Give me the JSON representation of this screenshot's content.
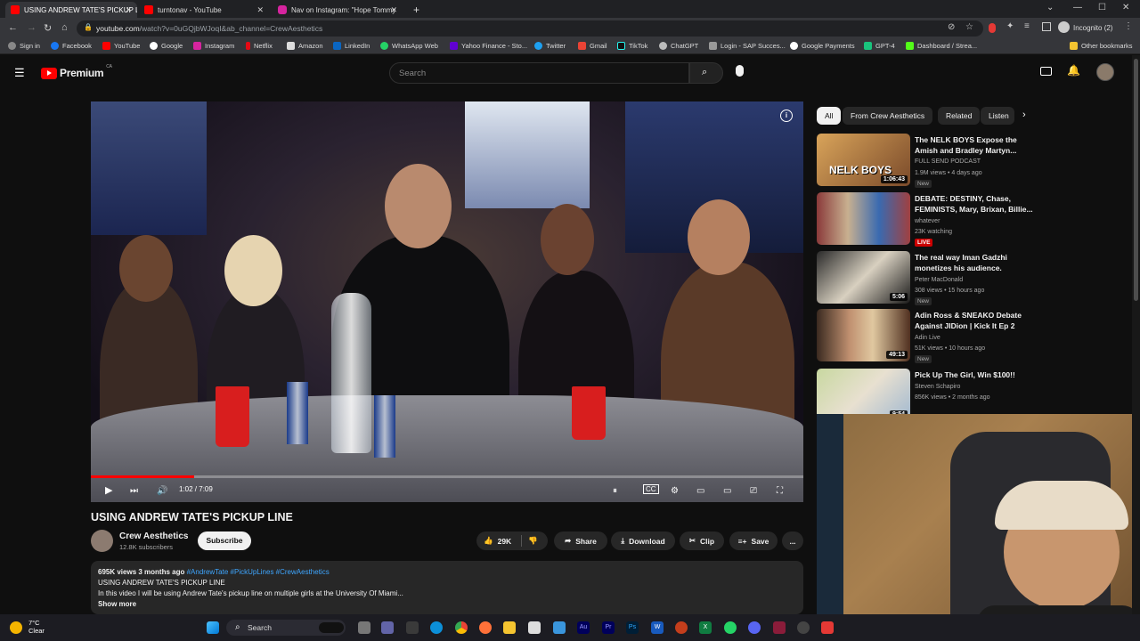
{
  "browser": {
    "tabs": [
      {
        "title": "USING ANDREW TATE'S PICKUP L",
        "favicon_color": "#ff0000"
      },
      {
        "title": "turntonav - YouTube",
        "favicon_color": "#ff0000"
      },
      {
        "title": "Nav on Instagram: \"Hope Tommy",
        "favicon_color": "#d6249f"
      }
    ],
    "new_tab": "+",
    "url_domain": "youtube.com",
    "url_path": "/watch?v=0uGQjbWJoqI&ab_channel=CrewAesthetics",
    "profile": "Incognito (2)",
    "bookmarks": [
      "Sign in",
      "Facebook",
      "YouTube",
      "Google",
      "Instagram",
      "Netflix",
      "Amazon",
      "LinkedIn",
      "WhatsApp Web",
      "Yahoo Finance - Sto...",
      "Twitter",
      "Gmail",
      "TikTok",
      "ChatGPT",
      "Login - SAP Succes...",
      "Google Payments",
      "GPT-4",
      "Dashboard / Strea..."
    ],
    "other_bookmarks": "Other bookmarks"
  },
  "youtube": {
    "logo_text": "Premium",
    "region": "CA",
    "search_placeholder": "Search",
    "video": {
      "time": "1:02 / 7:09",
      "progress": 0.145,
      "title": "USING ANDREW TATE'S PICKUP LINE",
      "channel": "Crew Aesthetics",
      "subscribers": "12.8K subscribers",
      "subscribe_label": "Subscribe",
      "likes": "29K",
      "share": "Share",
      "download": "Download",
      "clip": "Clip",
      "save": "Save",
      "more": "..."
    },
    "description": {
      "stats": "695K views  3 months ago",
      "hashtags": "#AndrewTate #PickUpLines #CrewAesthetics",
      "line1": "USING ANDREW TATE'S PICKUP LINE",
      "line2": "In this video I will be using Andrew Tate's pickup line on multiple girls at the University Of Miami...",
      "show_more": "Show more"
    },
    "chips": [
      "All",
      "From Crew Aesthetics",
      "Related",
      "Listen"
    ],
    "recommendations": [
      {
        "title": "The NELK BOYS Expose the Amish and Bradley Martyn...",
        "channel": "FULL SEND PODCAST",
        "meta": "1.9M views • 4 days ago",
        "badge": "New",
        "duration": "1:06:43",
        "thumb_text": "NELK BOYS"
      },
      {
        "title": "DEBATE: DESTINY, Chase, FEMINISTS, Mary, Brixan, Billie...",
        "channel": "whatever",
        "meta": "23K watching",
        "badge": "LIVE",
        "duration": "",
        "thumb_text": ""
      },
      {
        "title": "The real way Iman Gadzhi monetizes his audience.",
        "channel": "Peter MacDonald",
        "meta": "308 views • 15 hours ago",
        "badge": "New",
        "duration": "5:06",
        "thumb_text": ""
      },
      {
        "title": "Adin Ross & SNEAKO Debate Against JIDion | Kick It Ep 2",
        "channel": "Adin Live",
        "meta": "51K views • 10 hours ago",
        "badge": "New",
        "duration": "49:13",
        "thumb_text": ""
      },
      {
        "title": "Pick Up The Girl, Win $100!!",
        "channel": "Steven Schapiro",
        "meta": "856K views • 2 months ago",
        "badge": "",
        "duration": "9:54",
        "thumb_text": ""
      }
    ]
  },
  "taskbar": {
    "temperature": "7°C",
    "condition": "Clear",
    "search_label": "Search"
  }
}
